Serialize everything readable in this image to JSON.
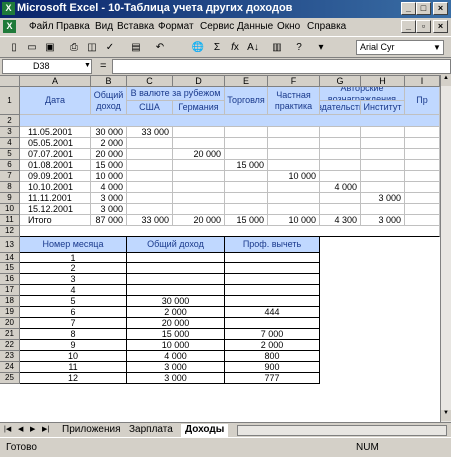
{
  "window": {
    "title": "Microsoft Excel - 10-Таблица учета других доходов"
  },
  "menu": [
    "Файл",
    "Правка",
    "Вид",
    "Вставка",
    "Формат",
    "Сервис",
    "Данные",
    "Окно",
    "Справка"
  ],
  "toolbar": {
    "font": "Arial Cyr"
  },
  "formula": {
    "cell_ref": "D38",
    "fx": "="
  },
  "columns": [
    "A",
    "B",
    "C",
    "D",
    "E",
    "F",
    "G",
    "H",
    "I"
  ],
  "rows": [
    "1",
    "2",
    "3",
    "4",
    "5",
    "6",
    "7",
    "8",
    "9",
    "10",
    "11",
    "12",
    "13",
    "14",
    "15",
    "16",
    "17",
    "18",
    "19",
    "20",
    "21",
    "22",
    "23",
    "24",
    "25"
  ],
  "table1": {
    "h_date": "Дата",
    "h_total": "Общий доход",
    "h_consult": "В валюте за рубежом",
    "h_usa": "США",
    "h_germany": "Германия",
    "h_trade": "Торговля",
    "h_practice": "Частная практика",
    "h_author": "Авторские вознаграждения",
    "h_pub": "Издательство",
    "h_inst": "Институт",
    "h_pr": "Пр",
    "rows": [
      [
        "11.05.2001",
        "30 000",
        "33 000",
        "",
        "",
        "",
        "",
        ""
      ],
      [
        "05.05.2001",
        "2 000",
        "",
        "",
        "",
        "",
        "",
        ""
      ],
      [
        "07.07.2001",
        "20 000",
        "",
        "20 000",
        "",
        "",
        "",
        ""
      ],
      [
        "01.08.2001",
        "15 000",
        "",
        "",
        "15 000",
        "",
        "",
        ""
      ],
      [
        "09.09.2001",
        "10 000",
        "",
        "",
        "",
        "10 000",
        "",
        ""
      ],
      [
        "10.10.2001",
        "4 000",
        "",
        "",
        "",
        "",
        "4 000",
        ""
      ],
      [
        "11.11.2001",
        "3 000",
        "",
        "",
        "",
        "",
        "",
        "3 000"
      ],
      [
        "15.12.2001",
        "3 000",
        "",
        "",
        "",
        "",
        "",
        ""
      ],
      [
        "Итого",
        "87 000",
        "33 000",
        "20 000",
        "15 000",
        "10 000",
        "4 300",
        "3 000"
      ]
    ]
  },
  "table2": {
    "h_month": "Номер месяца",
    "h_income": "Общий доход",
    "h_deduct": "Проф. вычеть",
    "rows": [
      [
        "1",
        "",
        ""
      ],
      [
        "2",
        "",
        ""
      ],
      [
        "3",
        "",
        ""
      ],
      [
        "4",
        "",
        ""
      ],
      [
        "5",
        "30 000",
        ""
      ],
      [
        "6",
        "2 000",
        "444"
      ],
      [
        "7",
        "20 000",
        ""
      ],
      [
        "8",
        "15 000",
        "7 000"
      ],
      [
        "9",
        "10 000",
        "2 000"
      ],
      [
        "10",
        "4 000",
        "800"
      ],
      [
        "11",
        "3 000",
        "900"
      ],
      [
        "12",
        "3 000",
        "777"
      ]
    ]
  },
  "sheets": [
    "Приложения",
    "Зарплата",
    "Доходы"
  ],
  "status": {
    "ready": "Готово",
    "num": "NUM"
  }
}
